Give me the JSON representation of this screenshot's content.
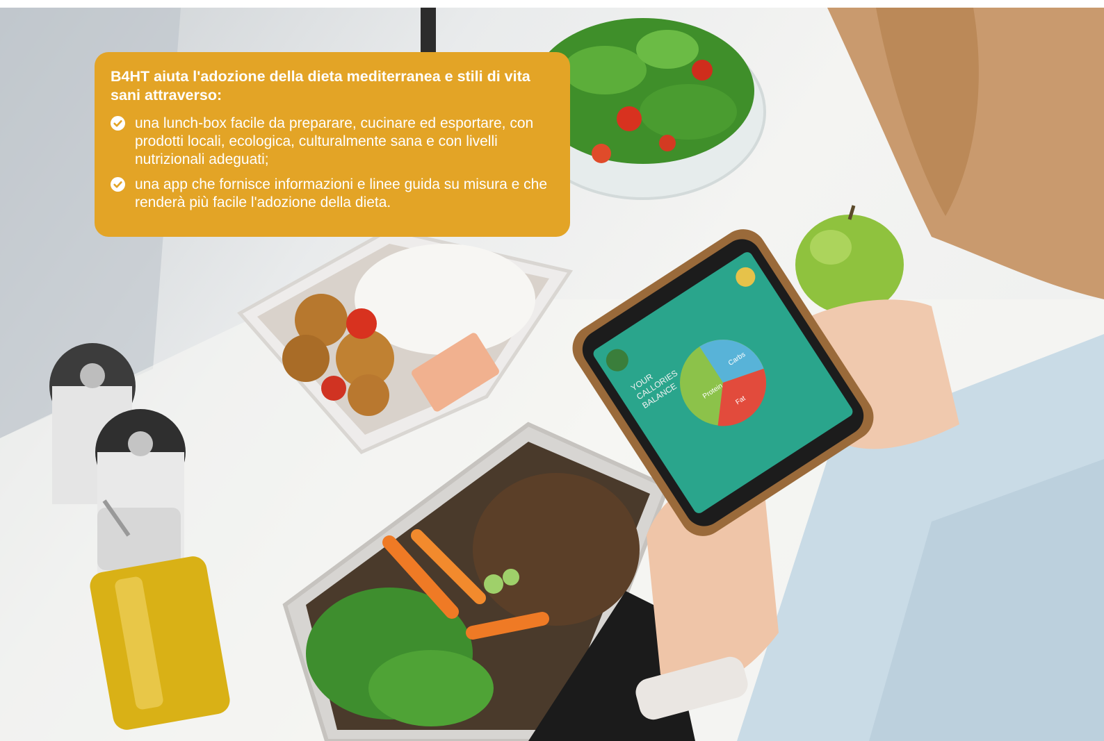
{
  "card": {
    "title": "B4HT aiuta l'adozione della dieta mediterranea e stili di vita sani attraverso:",
    "items": [
      {
        "icon": "check-circle-icon",
        "text": "una lunch-box facile da preparare, cucinare ed esportare, con prodotti locali, ecologica, culturalmente sana e con livelli nutrizionali adeguati;"
      },
      {
        "icon": "check-circle-icon",
        "text": "una app che fornisce informazioni e linee guida su misura e che renderà più facile l'adozione della dieta."
      }
    ],
    "background_color": "#e3a426",
    "text_color": "#ffffff"
  },
  "phone_screen": {
    "heading": "YOUR CALLORIES BALANCE",
    "chart_labels": [
      "Protein",
      "Carbs",
      "Fat"
    ],
    "screen_color": "#2aa58c"
  }
}
